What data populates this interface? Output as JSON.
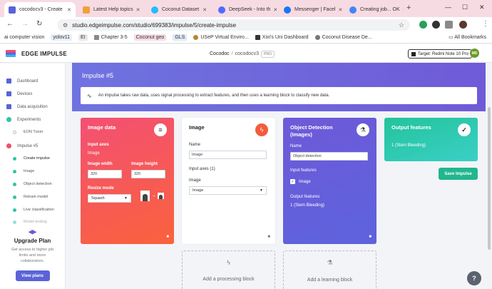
{
  "browser": {
    "tabs": [
      {
        "title": "cocodocv3 - Create",
        "favicon_color": "#5b63d7"
      },
      {
        "title": "Latest Help topics",
        "favicon_color": "#f0a13a"
      },
      {
        "title": "Coconut Dataset",
        "favicon_color": "#20beff"
      },
      {
        "title": "DeepSeek - Into th",
        "favicon_color": "#4d6bfe"
      },
      {
        "title": "Messenger | Facel",
        "favicon_color": "#1877f2"
      },
      {
        "title": "Creating job... OK",
        "favicon_color": "#4285f4"
      }
    ],
    "url": "studio.edgeimpulse.com/studio/699383/impulse/5/create-impulse",
    "bookmarks": [
      "ai computer vision",
      "yolov11",
      "EI",
      "Chapter 3-5",
      "Coconut geo",
      "GLS",
      "USeP Virtual Enviro...",
      "Xixi's Uni Dashboard",
      "Coconut Disease De..."
    ],
    "all_bookmarks": "All Bookmarks"
  },
  "header": {
    "logo": "EDGE IMPULSE",
    "breadcrumb_owner": "Cocodoc",
    "breadcrumb_project": "cocodocv3",
    "breadcrumb_badge": "PRO",
    "target": "Target: Redmi Note 10 Pro",
    "avatar": "MD"
  },
  "sidebar": {
    "items": [
      {
        "label": "Dashboard",
        "color": "#5b63d7"
      },
      {
        "label": "Devices",
        "color": "#5b63d7"
      },
      {
        "label": "Data acquisition",
        "color": "#5b63d7"
      },
      {
        "label": "Experiments",
        "color": "#2ec4a6"
      }
    ],
    "eon_tuner": "EON Tuner",
    "impulse": "Impulse #5",
    "subitems": [
      "Create impulse",
      "Image",
      "Object detection",
      "Retrain model",
      "Live classification",
      "Model testing"
    ],
    "upgrade_title": "Upgrade Plan",
    "upgrade_text": "Get access to higher job limits and more collaborators.",
    "view_plans": "View plans"
  },
  "main": {
    "title": "Impulse #5",
    "info": "An impulse takes raw data, uses signal processing to extract features, and then uses a learning block to classify new data.",
    "image_data": {
      "title": "Image data",
      "input_axes_label": "Input axes",
      "input_axes_value": "Image",
      "width_label": "Image width",
      "width_value": "320",
      "height_label": "Image height",
      "height_value": "320",
      "resize_label": "Resize mode",
      "resize_value": "Squash"
    },
    "processing": {
      "title": "Image",
      "name_label": "Name",
      "name_value": "Image",
      "input_axes_label": "Input axes (1)",
      "axis_label": "Image",
      "axis_select": "Image"
    },
    "learning": {
      "title": "Object Detection (Images)",
      "name_label": "Name",
      "name_value": "Object detection",
      "input_features_label": "Input features",
      "input_feature": "Image",
      "output_features_label": "Output features",
      "output_value": "1 (Stem Bleeding)"
    },
    "output": {
      "title": "Output features",
      "value": "1 (Stem Bleeding)"
    },
    "save_button": "Save Impulse",
    "add_processing": "Add a processing block",
    "add_learning": "Add a learning block",
    "help": "?"
  }
}
